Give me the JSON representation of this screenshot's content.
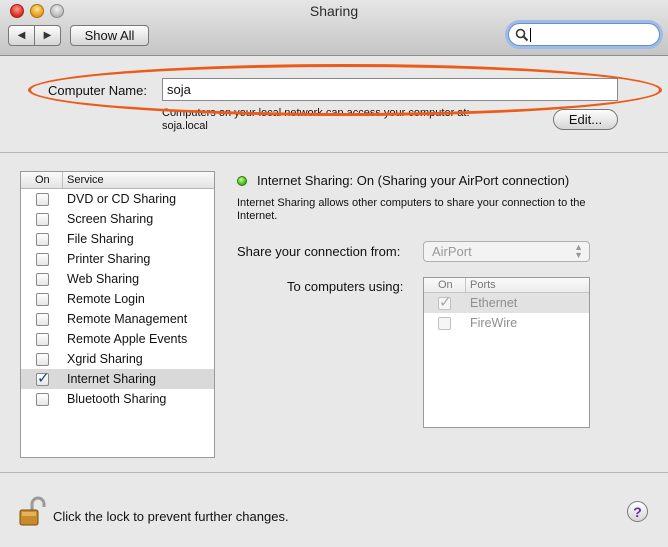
{
  "window": {
    "title": "Sharing"
  },
  "toolbar": {
    "back_icon": "◀",
    "forward_icon": "▶",
    "show_all_label": "Show All",
    "search_value": "",
    "search_placeholder": ""
  },
  "computer_name": {
    "label": "Computer Name:",
    "value": "soja",
    "description_line1": "Computers on your local network can access your computer at:",
    "description_line2": "soja.local",
    "edit_label": "Edit..."
  },
  "services": {
    "header_on": "On",
    "header_service": "Service",
    "items": [
      {
        "label": "DVD or CD Sharing",
        "checked": false
      },
      {
        "label": "Screen Sharing",
        "checked": false
      },
      {
        "label": "File Sharing",
        "checked": false
      },
      {
        "label": "Printer Sharing",
        "checked": false
      },
      {
        "label": "Web Sharing",
        "checked": false
      },
      {
        "label": "Remote Login",
        "checked": false
      },
      {
        "label": "Remote Management",
        "checked": false
      },
      {
        "label": "Remote Apple Events",
        "checked": false
      },
      {
        "label": "Xgrid Sharing",
        "checked": false
      },
      {
        "label": "Internet Sharing",
        "checked": true,
        "selected": true
      },
      {
        "label": "Bluetooth Sharing",
        "checked": false
      }
    ]
  },
  "detail": {
    "status_title": "Internet Sharing: On (Sharing your AirPort connection)",
    "status_color": "#3fae1a",
    "description_line1": "Internet Sharing allows other computers to share your connection to the",
    "description_line2": "Internet.",
    "share_from_label": "Share your connection from:",
    "share_from_value": "AirPort",
    "to_computers_label": "To computers using:",
    "ports_header_on": "On",
    "ports_header_ports": "Ports",
    "ports": [
      {
        "label": "Ethernet",
        "checked": true,
        "selected": true
      },
      {
        "label": "FireWire",
        "checked": false
      }
    ]
  },
  "footer": {
    "lock_text": "Click the lock to prevent further changes.",
    "help_label": "?"
  },
  "annotation": {
    "color": "#ee5a1a"
  }
}
